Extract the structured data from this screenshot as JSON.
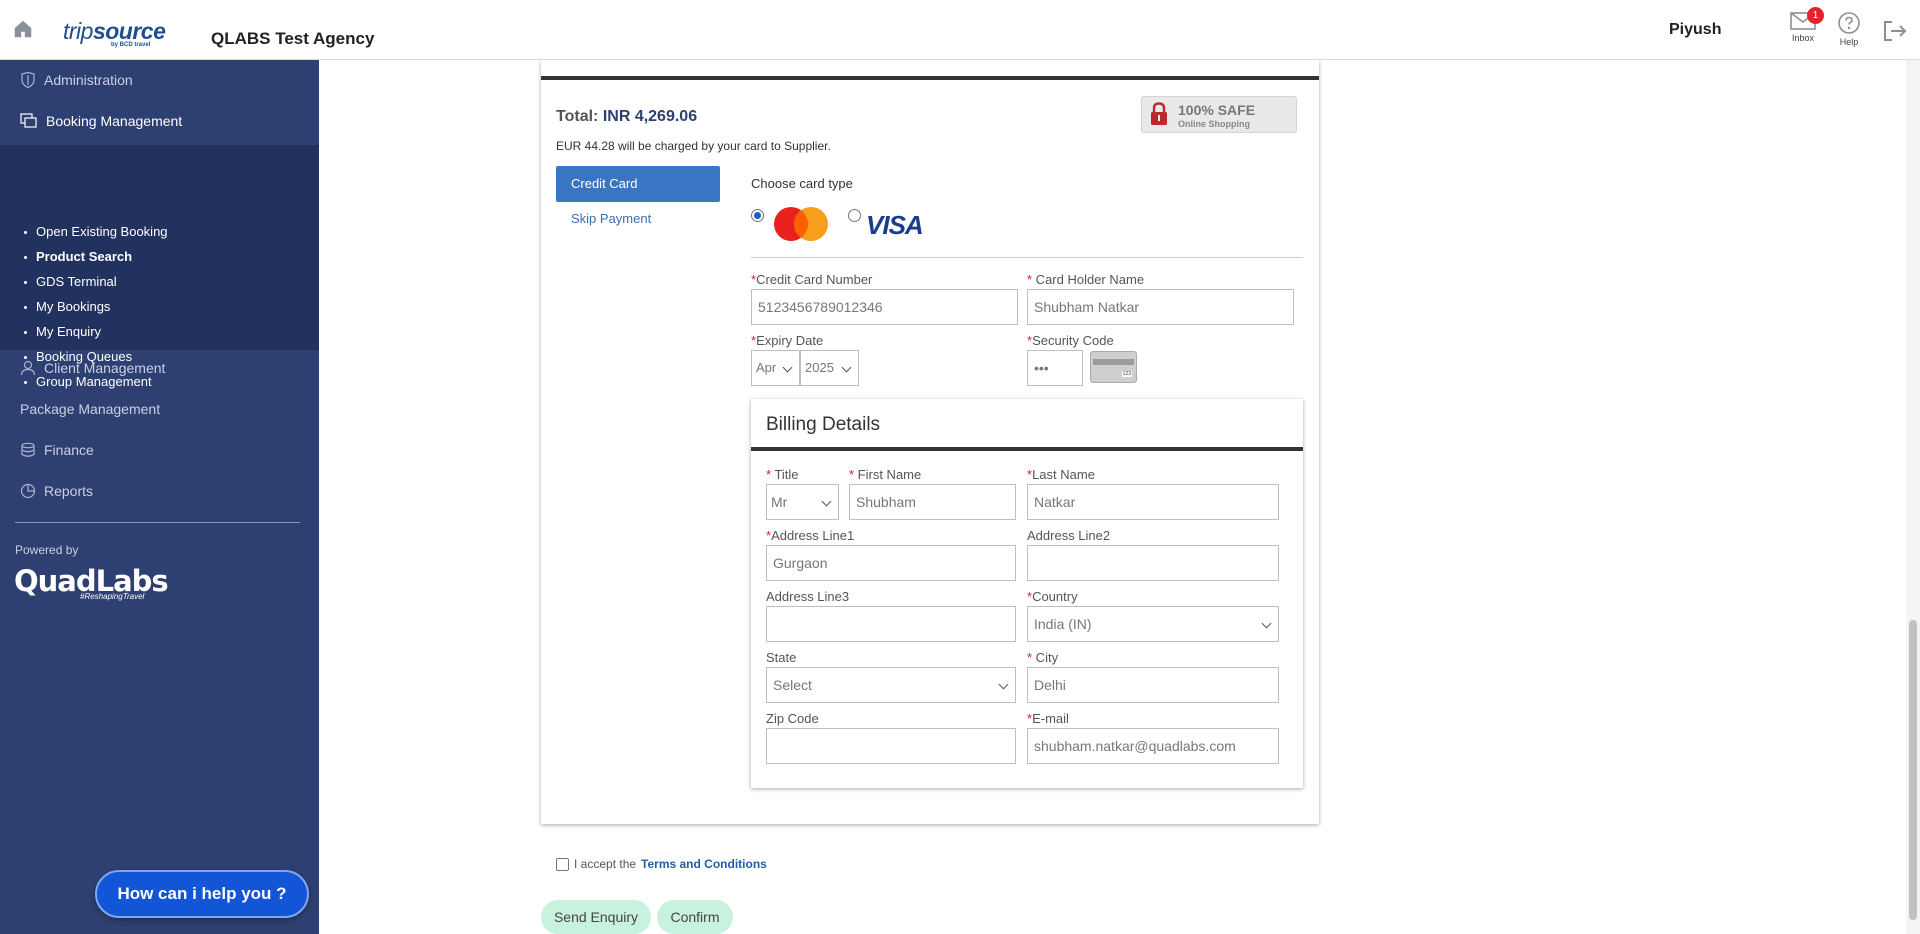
{
  "header": {
    "logo_trip": "trip",
    "logo_source": "source",
    "logo_sub": "by BCD travel",
    "agency": "QLABS Test Agency",
    "user": "Piyush",
    "inbox_label": "Inbox",
    "inbox_count": "1",
    "help_label": "Help"
  },
  "sidebar": {
    "administration": "Administration",
    "booking_management": "Booking Management",
    "submenu": [
      "Open Existing Booking",
      "Product Search",
      "GDS Terminal",
      "My Bookings",
      "My Enquiry",
      "Booking Queues",
      "Group Management"
    ],
    "client_management": "Client Management",
    "package_management": "Package Management",
    "finance": "Finance",
    "reports": "Reports",
    "powered_by": "Powered by",
    "powered_logo": "QuadLabs",
    "powered_tag": "#ReshapingTravel",
    "help_chat": "How can i help you ?"
  },
  "payment": {
    "total_label": "Total:",
    "total_value": "INR 4,269.06",
    "charge_note": "EUR 44.28 will be charged by your card to Supplier.",
    "safe_title": "100% SAFE",
    "safe_sub": "Online Shopping",
    "tab_credit_card": "Credit Card",
    "tab_skip": "Skip Payment",
    "choose_card_type": "Choose card type",
    "visa_text": "VISA",
    "card_number_label": "Credit Card Number",
    "card_number_value": "5123456789012346",
    "holder_label": " Card Holder Name",
    "holder_value": "Shubham Natkar",
    "expiry_label": "Expiry Date",
    "expiry_month": "Apr",
    "expiry_year": "2025",
    "security_label": "Security Code",
    "security_value": "•••"
  },
  "billing": {
    "title": "Billing Details",
    "title_label": " Title",
    "title_value": "Mr",
    "first_name_label": " First Name",
    "first_name_value": "Shubham",
    "last_name_label": "Last Name",
    "last_name_value": "Natkar",
    "address1_label": "Address Line1",
    "address1_value": "Gurgaon",
    "address2_label": "Address Line2",
    "address2_value": "",
    "address3_label": "Address Line3",
    "address3_value": "",
    "country_label": "Country",
    "country_value": "India (IN)",
    "state_label": "State",
    "state_value": "Select",
    "city_label": " City",
    "city_value": "Delhi",
    "zip_label": "Zip Code",
    "zip_value": "",
    "email_label": "E-mail",
    "email_value": "shubham.natkar@quadlabs.com"
  },
  "footer": {
    "accept_text": "I accept the",
    "terms_link": "Terms and Conditions",
    "send_enquiry": "Send Enquiry",
    "confirm": "Confirm"
  },
  "colors": {
    "sidebar_bg": "#2e3f72",
    "submenu_bg": "#22325f",
    "tab_active": "#3a75c4",
    "soft_button": "#c6f2de",
    "required": "#d4202c"
  }
}
